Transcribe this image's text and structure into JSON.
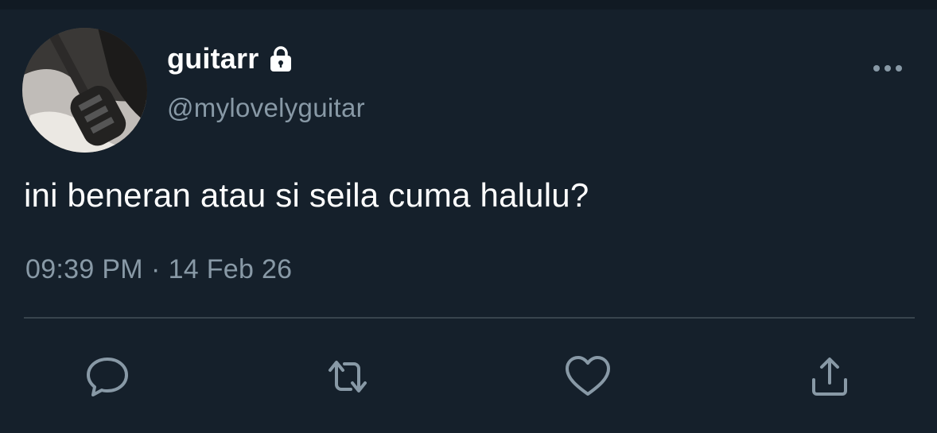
{
  "colors": {
    "background": "#15202b",
    "primary_text": "#ffffff",
    "secondary_text": "#8899a6",
    "divider": "#38444d"
  },
  "author": {
    "display_name": "guitarr",
    "handle": "@mylovelyguitar",
    "protected_icon": "lock-icon",
    "avatar_icon": "avatar-photo-guitar"
  },
  "tweet": {
    "text": "ini beneran atau si seila cuma halulu?",
    "time": "09:39 PM",
    "separator": "·",
    "date": "14 Feb 26"
  },
  "actions": [
    {
      "icon": "reply-icon"
    },
    {
      "icon": "retweet-icon"
    },
    {
      "icon": "like-icon"
    },
    {
      "icon": "share-icon"
    }
  ],
  "menu": {
    "icon": "more-options-icon"
  }
}
